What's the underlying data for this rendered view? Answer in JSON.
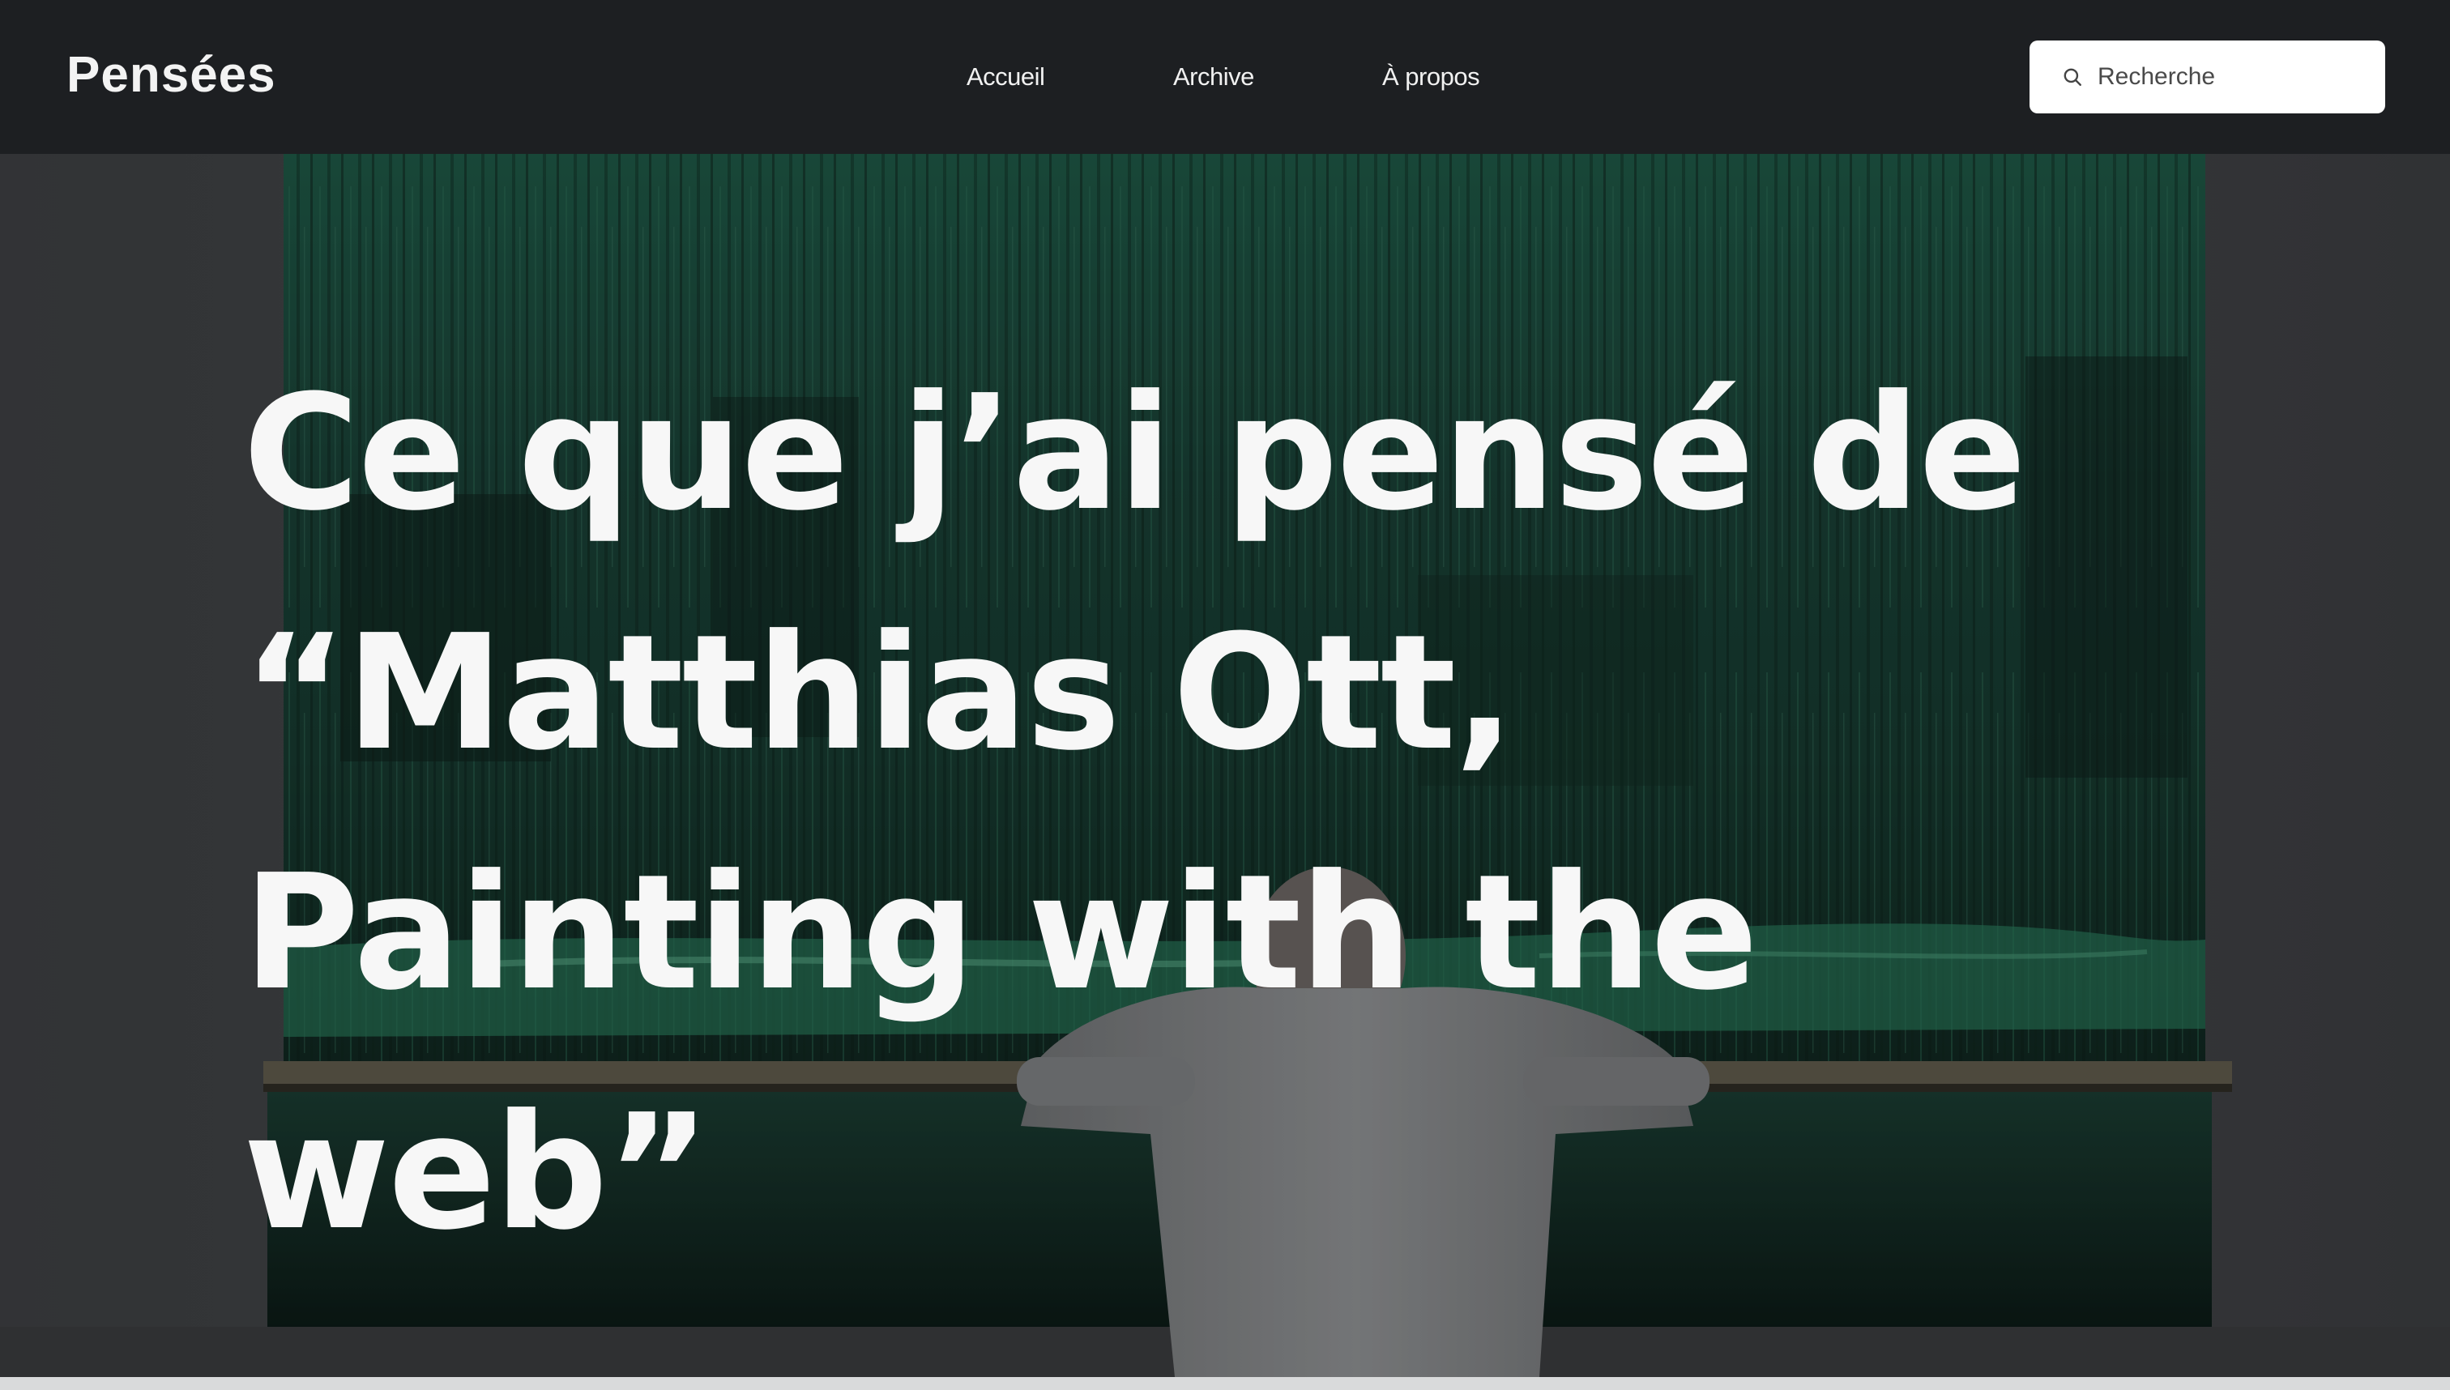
{
  "site": {
    "brand": "Pensées"
  },
  "nav": {
    "items": [
      {
        "label": "Accueil"
      },
      {
        "label": "Archive"
      },
      {
        "label": "À propos"
      }
    ]
  },
  "search": {
    "placeholder": "Recherche",
    "value": "",
    "icon": "search-icon"
  },
  "hero": {
    "title": "Ce que j’ai pensé de “Matthias Ott, Painting with the web”",
    "image": "painter-in-front-of-large-green-abstract-painting"
  },
  "colors": {
    "header_bg": "#1d1f22",
    "title_text": "#f7f7f7",
    "search_bg": "#ffffff",
    "painting_green": "#1f5c49"
  }
}
